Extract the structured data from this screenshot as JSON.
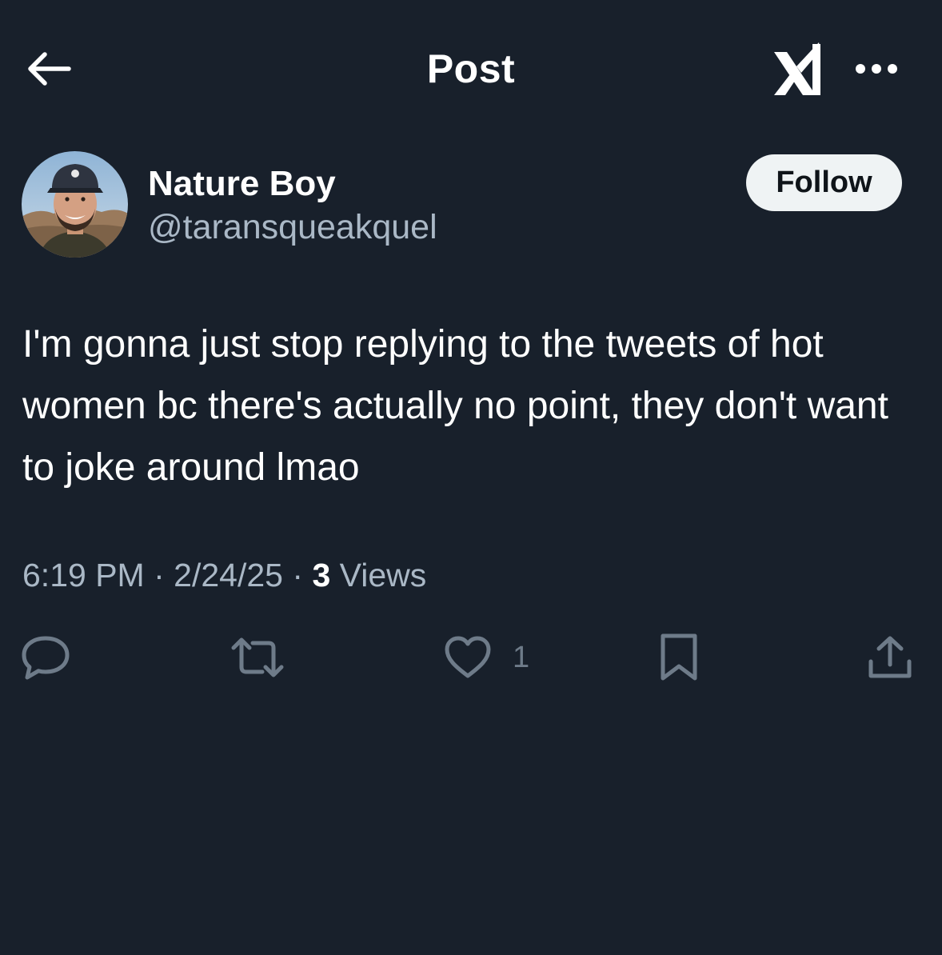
{
  "header": {
    "title": "Post",
    "back_icon": "arrow-left-icon",
    "grok_icon": "grok-icon",
    "more_icon": "more-horizontal-icon"
  },
  "author": {
    "display_name": "Nature Boy",
    "handle": "@taransqueakquel",
    "follow_label": "Follow"
  },
  "post": {
    "text": "I'm gonna just stop replying to the tweets of hot women bc there's actually no point, they don't want to joke around lmao",
    "time": "6:19 PM",
    "separator": "·",
    "date": "2/24/25",
    "views_count": "3",
    "views_label": "Views"
  },
  "actions": {
    "reply_icon": "reply-icon",
    "repost_icon": "repost-icon",
    "like_icon": "heart-icon",
    "like_count": "1",
    "bookmark_icon": "bookmark-icon",
    "share_icon": "share-icon"
  },
  "colors": {
    "background": "#18202b",
    "text_primary": "#ffffff",
    "text_secondary": "#aab8c6",
    "action_icon": "#6e7b89",
    "follow_bg": "#eff3f4"
  }
}
